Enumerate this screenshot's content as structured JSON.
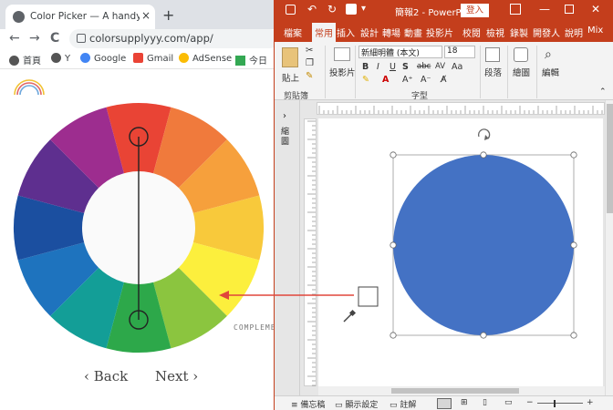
{
  "browser": {
    "tab_title": "Color Picker — A handy design",
    "tab_close": "×",
    "new_tab": "+",
    "back": "←",
    "forward": "→",
    "reload": "C",
    "url": "colorsupplyyy.com/app/",
    "bookmarks": [
      {
        "label": "首頁",
        "icon": "globe-icon"
      },
      {
        "label": "Y",
        "icon": "globe-icon"
      },
      {
        "label": "Google",
        "icon": "google-icon"
      },
      {
        "label": "Gmail",
        "icon": "gmail-icon"
      },
      {
        "label": "AdSense",
        "icon": "adsense-icon"
      },
      {
        "label": "今日",
        "icon": "drive-icon"
      }
    ]
  },
  "picker": {
    "back_label": "‹ Back",
    "next_label": "Next ›",
    "complement_label": "COMPLEME",
    "wheel_colors": [
      "#e94435",
      "#f07a3c",
      "#f6a03c",
      "#f8c93b",
      "#fcef3d",
      "#8bc53f",
      "#2da84a",
      "#139e97",
      "#1e73be",
      "#1b4fa0",
      "#5e2f8f",
      "#9d2d8f"
    ]
  },
  "ppt": {
    "title": "簡報2 - PowerPo...",
    "signin": "登入",
    "tabs": [
      "檔案",
      "常用",
      "插入",
      "設計",
      "轉場",
      "動畫",
      "投影片",
      "校閱",
      "檢視",
      "錄製",
      "開發人",
      "說明",
      "Mix"
    ],
    "active_tab": "常用",
    "paste_label": "貼上",
    "clipboard_group": "剪貼簿",
    "slides_label": "投影片",
    "font_name": "新細明體 (本文)",
    "font_size": "18",
    "font_group": "字型",
    "paragraph_label": "段落",
    "drawing_label": "繪圖",
    "editing_label": "編輯",
    "thumb_label": "縮圖",
    "status_notes": "備忘稿",
    "status_display": "顯示設定",
    "status_comments": "註解",
    "accent": "#c43e1c",
    "circle_fill": "#4472c4"
  }
}
